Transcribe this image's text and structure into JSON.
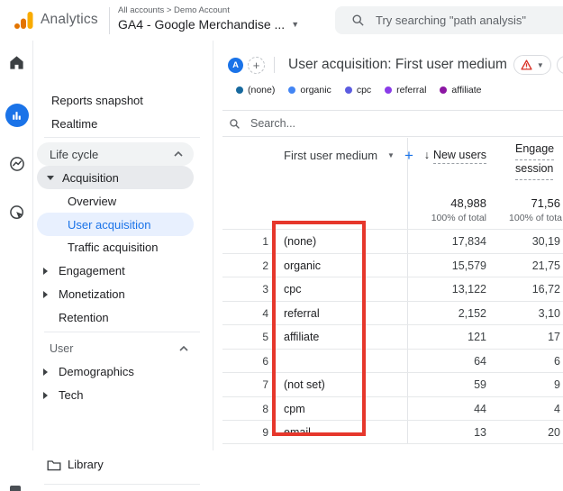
{
  "topbar": {
    "product": "Analytics",
    "breadcrumb": "All accounts > Demo Account",
    "property": "GA4 - Google Merchandise ...",
    "property_caret": "▼",
    "search_placeholder": "Try searching \"path analysis\""
  },
  "sidebar": {
    "items": [
      {
        "label": "Reports snapshot"
      },
      {
        "label": "Realtime"
      },
      {
        "label": "Life cycle"
      },
      {
        "label": "Acquisition"
      },
      {
        "label": "Overview"
      },
      {
        "label": "User acquisition"
      },
      {
        "label": "Traffic acquisition"
      },
      {
        "label": "Engagement"
      },
      {
        "label": "Monetization"
      },
      {
        "label": "Retention"
      },
      {
        "label": "User"
      },
      {
        "label": "Demographics"
      },
      {
        "label": "Tech"
      },
      {
        "label": "Library"
      }
    ],
    "selected_color": "#1a73e8",
    "selected_bg": "#e8f0fe"
  },
  "report_header": {
    "profile_chip": "A",
    "add_comparison": "+",
    "title": "User acquisition: First user medium"
  },
  "legend": {
    "items": [
      {
        "label": "(none)",
        "color": "#17699e"
      },
      {
        "label": "organic",
        "color": "#4285f4"
      },
      {
        "label": "cpc",
        "color": "#5c5ce0"
      },
      {
        "label": "referral",
        "color": "#8a3ce8"
      },
      {
        "label": "affiliate",
        "color": "#8c16a3"
      }
    ]
  },
  "table": {
    "search_placeholder": "Search...",
    "dimension_header": "First user medium",
    "dimension_caret": "▼",
    "add_metric": "+",
    "metric1_sort": "↓",
    "metric1_header": "New users",
    "metric2_header_line1": "Engage",
    "metric2_header_line2": "session",
    "totals": {
      "metric1": "48,988",
      "metric1_caption": "100% of total",
      "metric2": "71,56",
      "metric2_caption": "100% of tota"
    },
    "rows": [
      {
        "index": "1",
        "dimension": "(none)",
        "metric1": "17,834",
        "metric2": "30,19"
      },
      {
        "index": "2",
        "dimension": "organic",
        "metric1": "15,579",
        "metric2": "21,75"
      },
      {
        "index": "3",
        "dimension": "cpc",
        "metric1": "13,122",
        "metric2": "16,72"
      },
      {
        "index": "4",
        "dimension": "referral",
        "metric1": "2,152",
        "metric2": "3,10"
      },
      {
        "index": "5",
        "dimension": "affiliate",
        "metric1": "121",
        "metric2": "17"
      },
      {
        "index": "6",
        "dimension": "",
        "metric1": "64",
        "metric2": "6"
      },
      {
        "index": "7",
        "dimension": "(not set)",
        "metric1": "59",
        "metric2": "9"
      },
      {
        "index": "8",
        "dimension": "cpm",
        "metric1": "44",
        "metric2": "4"
      },
      {
        "index": "9",
        "dimension": "email",
        "metric1": "13",
        "metric2": "20"
      }
    ]
  },
  "annotation": {
    "highlight_box_color": "#e6372c"
  }
}
